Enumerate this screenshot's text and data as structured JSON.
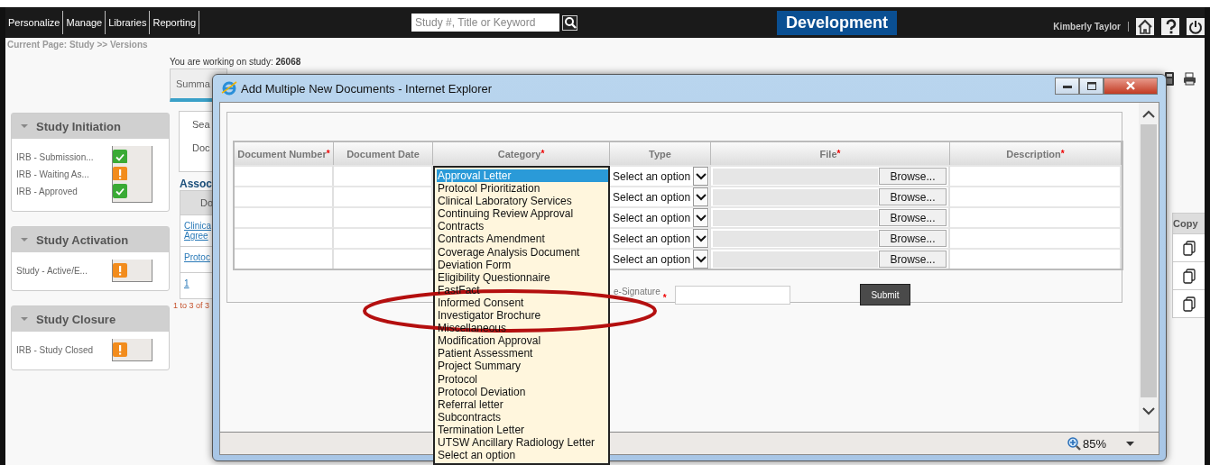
{
  "topbar": {
    "nav": [
      "Personalize",
      "Manage",
      "Libraries",
      "Reporting"
    ],
    "search": {
      "placeholder": "Study #, Title or Keyword"
    },
    "environment": "Development",
    "user": "Kimberly Taylor"
  },
  "breadcrumb": "Current Page: Study >> Versions",
  "sidebar": [
    {
      "title": "Study Initiation",
      "expanded": true,
      "items": [
        {
          "label": "IRB - Submission...",
          "complete": true
        },
        {
          "label": "IRB - Waiting As...",
          "complete": false
        },
        {
          "label": "IRB - Approved",
          "complete": true
        }
      ]
    },
    {
      "title": "Study Activation",
      "expanded": true,
      "items": [
        {
          "label": "Study - Active/E...",
          "complete": false
        }
      ]
    },
    {
      "title": "Study Closure",
      "expanded": true,
      "items": [
        {
          "label": "IRB - Study Closed",
          "complete": false
        }
      ]
    }
  ],
  "study": {
    "working_on": "You are working on study: **26068**",
    "tab": "Summa",
    "search_labels": [
      "Sea",
      "Doc"
    ],
    "section": "Assoc",
    "column": "Do",
    "rows": [
      {
        "links": [
          "Clinica",
          "Agree"
        ]
      },
      {
        "links": [
          "Protoc"
        ]
      },
      {
        "links": [
          "1"
        ]
      }
    ],
    "pager": "1 to 3 of 3",
    "copy_column": "Copy"
  },
  "dialog": {
    "title": "Add Multiple New Documents - Internet Explorer",
    "columns": [
      {
        "label": "Document Number",
        "mark": "*"
      },
      {
        "label": "Document Date"
      },
      {
        "label": "Category",
        "mark": "*"
      },
      {
        "label": "Type"
      },
      {
        "label": "File",
        "mark": "*"
      },
      {
        "label": "Description",
        "mark": "*"
      }
    ],
    "rows": [
      {
        "type": "Select an option",
        "browse": "Browse..."
      },
      {
        "type": "Select an option",
        "browse": "Browse..."
      },
      {
        "type": "Select an option",
        "browse": "Browse..."
      },
      {
        "type": "Select an option",
        "browse": "Browse..."
      },
      {
        "type": "Select an option",
        "browse": "Browse..."
      }
    ],
    "category_options": [
      {
        "label": "Approval Letter",
        "selected": true
      },
      {
        "label": "Protocol Prioritization",
        "selected": false
      },
      {
        "label": "Clinical Laboratory Services",
        "selected": false
      },
      {
        "label": "Continuing Review Approval",
        "selected": false
      },
      {
        "label": "Contracts",
        "selected": false
      },
      {
        "label": "Contracts Amendment",
        "selected": false
      },
      {
        "label": "Coverage Analysis Document",
        "selected": false
      },
      {
        "label": "Deviation Form",
        "selected": false
      },
      {
        "label": "Eligibility Questionnaire",
        "selected": false
      },
      {
        "label": "FastFact",
        "selected": false
      },
      {
        "label": "Informed Consent",
        "selected": false
      },
      {
        "label": "Investigator Brochure",
        "selected": false
      },
      {
        "label": "Miscellaneous",
        "selected": false
      },
      {
        "label": "Modification Approval",
        "selected": false
      },
      {
        "label": "Patient Assessment",
        "selected": false
      },
      {
        "label": "Project Summary",
        "selected": false
      },
      {
        "label": "Protocol",
        "selected": false
      },
      {
        "label": "Protocol Deviation",
        "selected": false
      },
      {
        "label": "Referral letter",
        "selected": false
      },
      {
        "label": "Subcontracts",
        "selected": false
      },
      {
        "label": "Termination Letter",
        "selected": false
      },
      {
        "label": "UTSW Ancillary Radiology Letter",
        "selected": false
      },
      {
        "label": "Select an option",
        "selected": false
      }
    ],
    "esignature": {
      "label": "e-Signature",
      "mark": "*"
    },
    "submit": "Submit",
    "zoom": "85%"
  }
}
